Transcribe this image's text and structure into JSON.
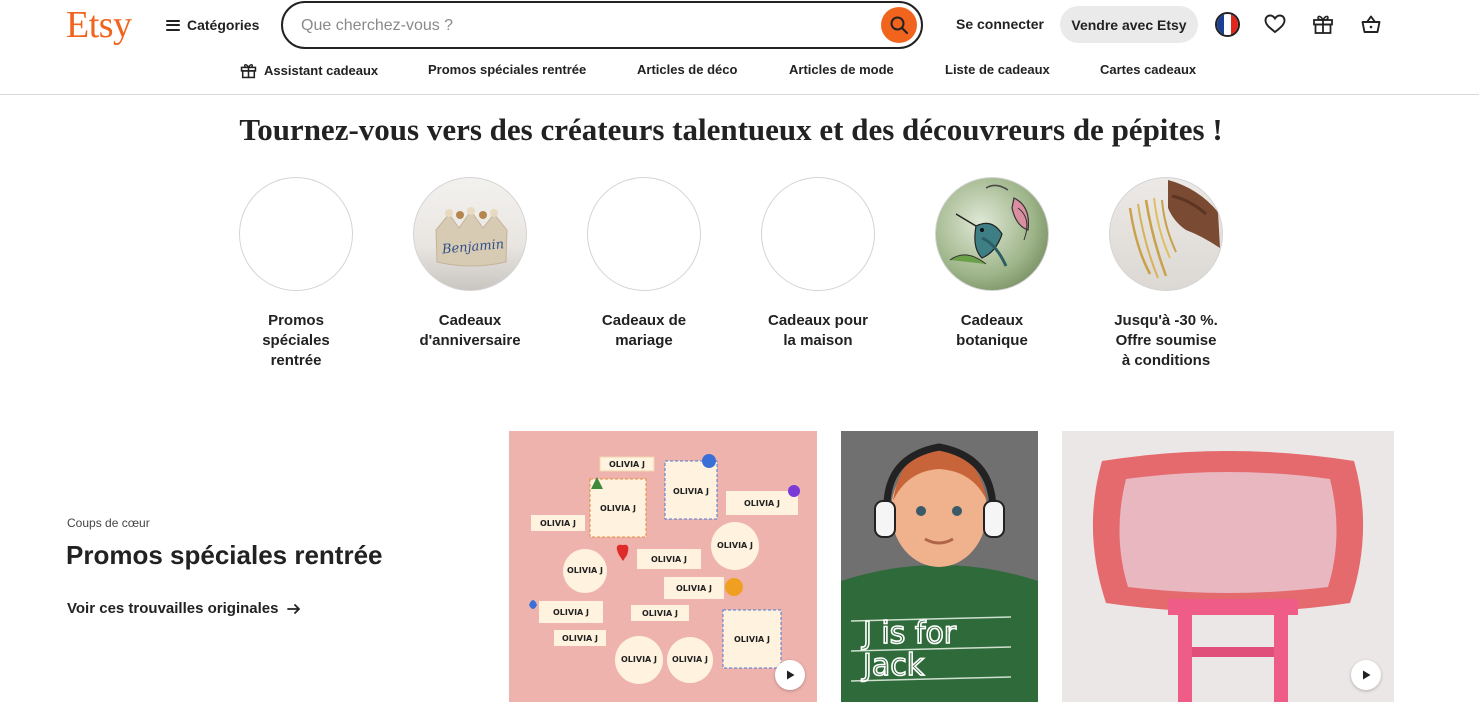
{
  "header": {
    "logo": "Etsy",
    "categories_label": "Catégories",
    "search_placeholder": "Que cherchez-vous ?",
    "signin_label": "Se connecter",
    "sell_label": "Vendre avec Etsy",
    "icons": [
      "search-icon",
      "flag-icon",
      "heart-icon",
      "gift-icon",
      "basket-icon"
    ],
    "accent_color": "#F1641E"
  },
  "subnav": {
    "items": [
      {
        "label": "Assistant cadeaux",
        "icon": "gift-icon"
      },
      {
        "label": "Promos spéciales rentrée"
      },
      {
        "label": "Articles de déco"
      },
      {
        "label": "Articles de mode"
      },
      {
        "label": "Liste de cadeaux"
      },
      {
        "label": "Cartes cadeaux"
      }
    ]
  },
  "hero": {
    "heading": "Tournez-vous vers des créateurs talentueux et des découvreurs de pépites !"
  },
  "circles": [
    {
      "label_lines": [
        "Promos",
        "spéciales",
        "rentrée"
      ]
    },
    {
      "label_lines": [
        "Cadeaux",
        "d'anniversaire"
      ],
      "image_text": "Benjamin"
    },
    {
      "label_lines": [
        "Cadeaux de",
        "mariage"
      ]
    },
    {
      "label_lines": [
        "Cadeaux pour",
        "la maison"
      ]
    },
    {
      "label_lines": [
        "Cadeaux",
        "botanique"
      ]
    },
    {
      "label_lines": [
        "Jusqu'à -30 %.",
        "Offre soumise",
        "à conditions"
      ]
    }
  ],
  "feature": {
    "eyebrow": "Coups de cœur",
    "title": "Promos spéciales rentrée",
    "link": "Voir ces trouvailles originales",
    "tiles": [
      {
        "image": "name-labels-stickers",
        "sticker_text": "OLIVIA J",
        "has_play": true
      },
      {
        "image": "boy-with-headphones",
        "shirt_text": [
          "J is for",
          "Jack"
        ],
        "has_play": false
      },
      {
        "image": "pink-ruffle-pillow-on-stool",
        "has_play": true
      }
    ]
  }
}
